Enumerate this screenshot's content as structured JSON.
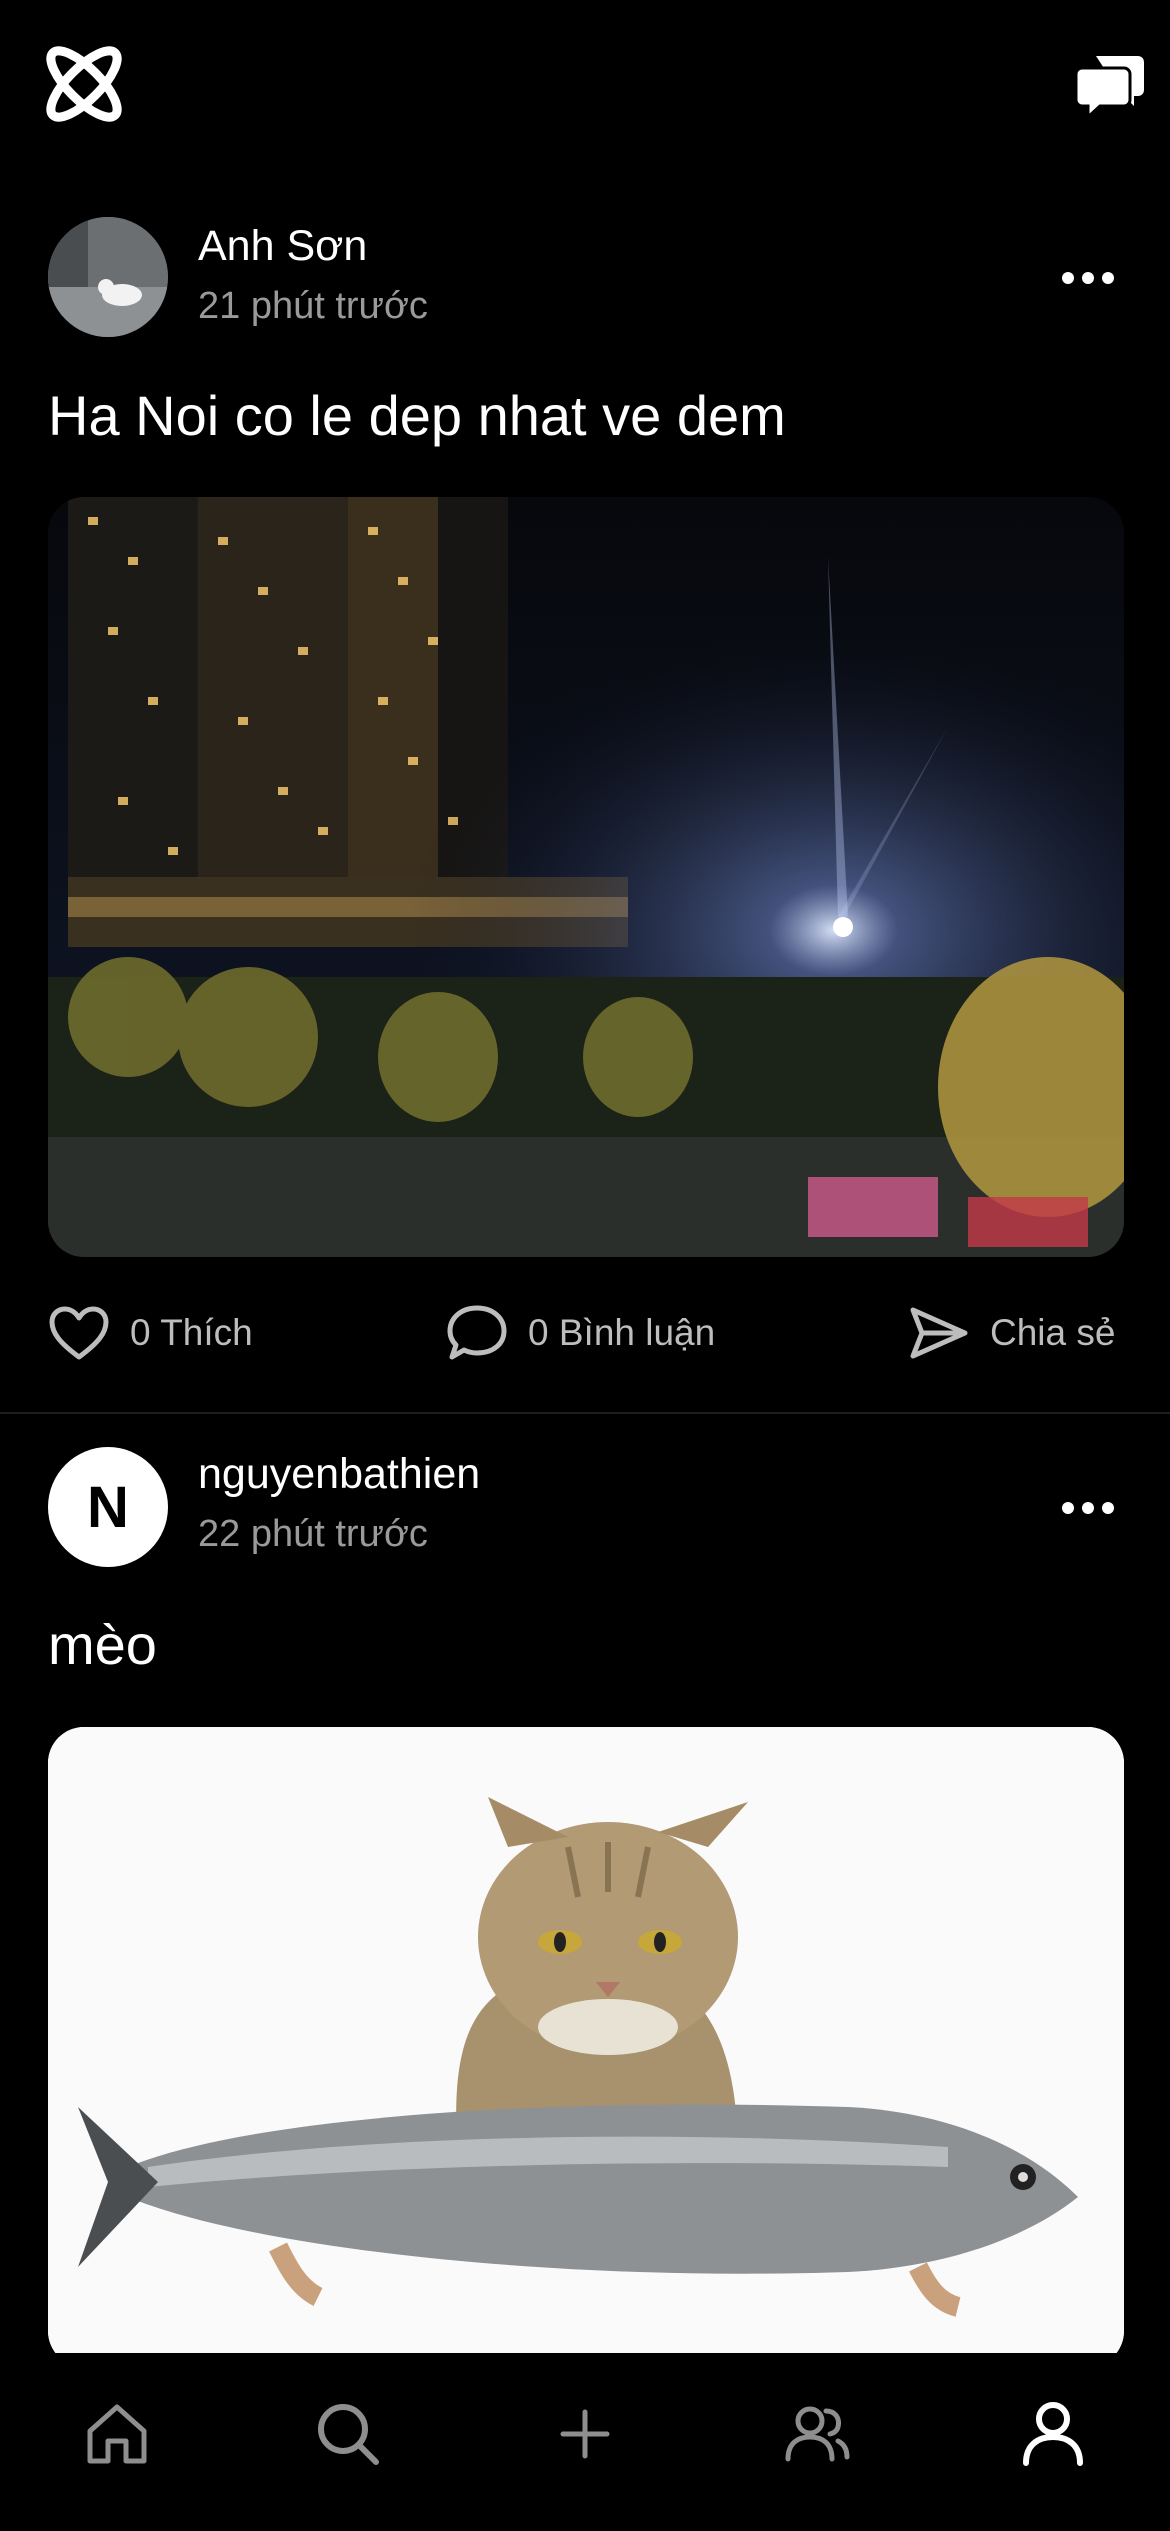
{
  "header": {
    "logo_icon": "app-logo-x",
    "chat_icon": "chat-bubbles-icon"
  },
  "posts": [
    {
      "username": "Anh Sơn",
      "time": "21 phút trước",
      "caption": "Ha Noi co le dep nhat ve dem",
      "avatar": "photo",
      "image_desc_icon": "night-city-photo",
      "like_label": "0 Thích",
      "comment_label": "0 Bình luận",
      "share_label": "Chia sẻ"
    },
    {
      "username": "nguyenbathien",
      "time": "22 phút trước",
      "caption": "mèo",
      "avatar_letter": "N",
      "image_desc_icon": "cat-with-fish-photo"
    }
  ],
  "bottom_nav": {
    "items": [
      "home-icon",
      "search-icon",
      "plus-icon",
      "friends-icon",
      "profile-icon"
    ],
    "active": "profile-icon"
  },
  "colors": {
    "background": "#000000",
    "text": "#ffffff",
    "muted": "#9a9a9a",
    "action": "#bdbdbd"
  }
}
